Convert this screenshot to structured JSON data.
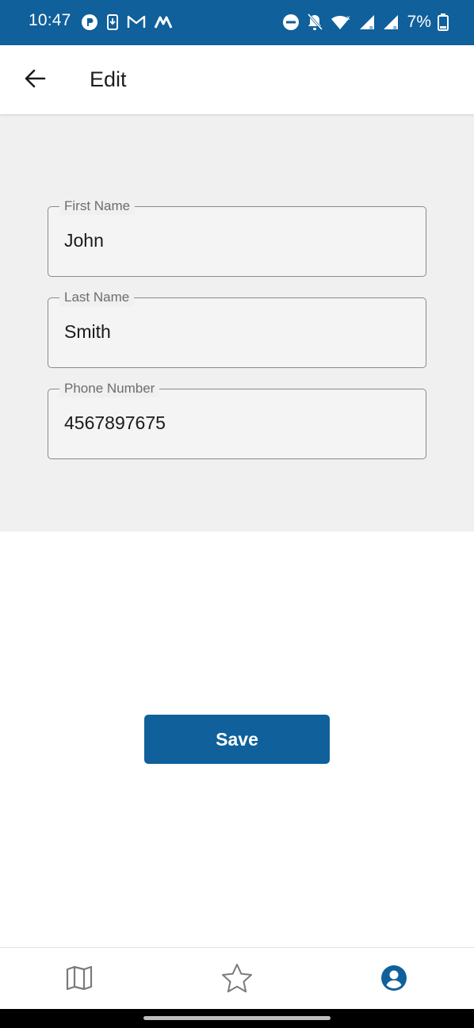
{
  "status_bar": {
    "time": "10:47",
    "battery": "7%",
    "background_color": "#0f609b",
    "left_icons": [
      "app-r-icon",
      "download-icon",
      "gmail-icon",
      "m-app-icon"
    ],
    "right_icons": [
      "do-not-disturb-icon",
      "notifications-off-icon",
      "wifi-icon",
      "signal-r-icon",
      "signal-r-icon",
      "battery-icon"
    ]
  },
  "app_bar": {
    "title": "Edit",
    "back_icon": "arrow-back-icon"
  },
  "form": {
    "first_name": {
      "label": "First Name",
      "value": "John"
    },
    "last_name": {
      "label": "Last Name",
      "value": "Smith"
    },
    "phone": {
      "label": "Phone Number",
      "value": "4567897675"
    }
  },
  "actions": {
    "save_label": "Save",
    "accent_color": "#0f609b"
  },
  "bottom_nav": {
    "items": [
      {
        "icon": "map-icon",
        "active": false
      },
      {
        "icon": "star-icon",
        "active": false
      },
      {
        "icon": "account-circle-icon",
        "active": true
      }
    ],
    "active_color": "#0f609b",
    "inactive_color": "#7a7a7a"
  }
}
